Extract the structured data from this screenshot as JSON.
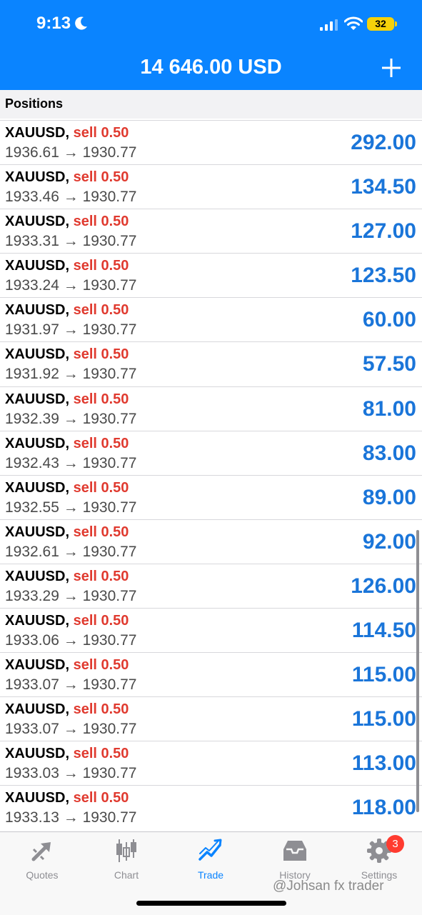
{
  "status": {
    "time": "9:13",
    "battery": "32"
  },
  "header": {
    "balance": "14 646.00 USD",
    "add_icon": "plus-icon"
  },
  "section": {
    "title": "Positions"
  },
  "positions": [
    {
      "symbol": "XAUUSD,",
      "side": "sell 0.50",
      "prices": "1936.61 → 1930.77",
      "profit": "292.00"
    },
    {
      "symbol": "XAUUSD,",
      "side": "sell 0.50",
      "prices": "1933.46 → 1930.77",
      "profit": "134.50"
    },
    {
      "symbol": "XAUUSD,",
      "side": "sell 0.50",
      "prices": "1933.31 → 1930.77",
      "profit": "127.00"
    },
    {
      "symbol": "XAUUSD,",
      "side": "sell 0.50",
      "prices": "1933.24 → 1930.77",
      "profit": "123.50"
    },
    {
      "symbol": "XAUUSD,",
      "side": "sell 0.50",
      "prices": "1931.97 → 1930.77",
      "profit": "60.00"
    },
    {
      "symbol": "XAUUSD,",
      "side": "sell 0.50",
      "prices": "1931.92 → 1930.77",
      "profit": "57.50"
    },
    {
      "symbol": "XAUUSD,",
      "side": "sell 0.50",
      "prices": "1932.39 → 1930.77",
      "profit": "81.00"
    },
    {
      "symbol": "XAUUSD,",
      "side": "sell 0.50",
      "prices": "1932.43 → 1930.77",
      "profit": "83.00"
    },
    {
      "symbol": "XAUUSD,",
      "side": "sell 0.50",
      "prices": "1932.55 → 1930.77",
      "profit": "89.00"
    },
    {
      "symbol": "XAUUSD,",
      "side": "sell 0.50",
      "prices": "1932.61 → 1930.77",
      "profit": "92.00"
    },
    {
      "symbol": "XAUUSD,",
      "side": "sell 0.50",
      "prices": "1933.29 → 1930.77",
      "profit": "126.00"
    },
    {
      "symbol": "XAUUSD,",
      "side": "sell 0.50",
      "prices": "1933.06 → 1930.77",
      "profit": "114.50"
    },
    {
      "symbol": "XAUUSD,",
      "side": "sell 0.50",
      "prices": "1933.07 → 1930.77",
      "profit": "115.00"
    },
    {
      "symbol": "XAUUSD,",
      "side": "sell 0.50",
      "prices": "1933.07 → 1930.77",
      "profit": "115.00"
    },
    {
      "symbol": "XAUUSD,",
      "side": "sell 0.50",
      "prices": "1933.03 → 1930.77",
      "profit": "113.00"
    },
    {
      "symbol": "XAUUSD,",
      "side": "sell 0.50",
      "prices": "1933.13 → 1930.77",
      "profit": "118.00"
    }
  ],
  "tabs": [
    {
      "label": "Quotes",
      "icon": "quotes-icon",
      "active": false
    },
    {
      "label": "Chart",
      "icon": "candlestick-icon",
      "active": false
    },
    {
      "label": "Trade",
      "icon": "trade-icon",
      "active": true
    },
    {
      "label": "History",
      "icon": "inbox-icon",
      "active": false
    },
    {
      "label": "Settings",
      "icon": "gear-icon",
      "active": false,
      "badge": "3"
    }
  ],
  "watermark": "@Johsan fx trader",
  "colors": {
    "accent": "#0a84ff",
    "sell": "#e03a2f",
    "profit": "#1a75d9"
  }
}
